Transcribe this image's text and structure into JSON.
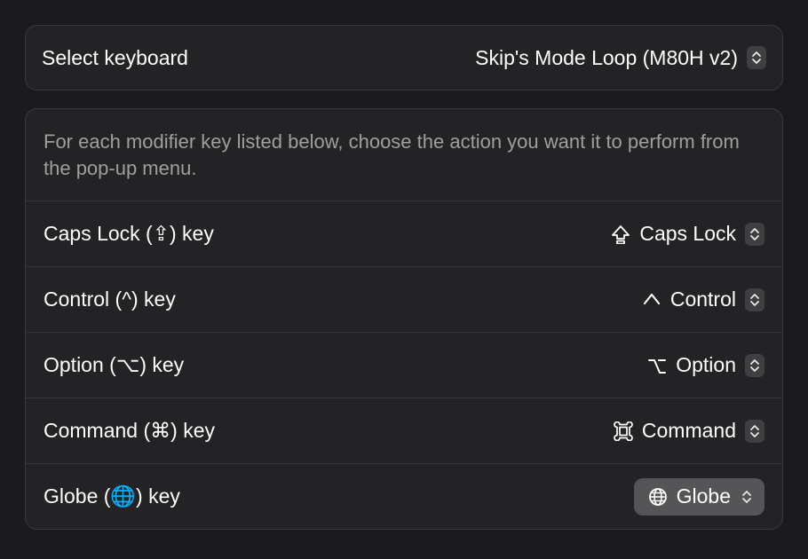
{
  "keyboard_selector": {
    "label": "Select keyboard",
    "value": "Skip's Mode Loop (M80H v2)"
  },
  "description": "For each modifier key listed below, choose the action you want it to perform from the pop-up menu.",
  "rows": [
    {
      "label": "Caps Lock (⇪) key",
      "icon": "capslock",
      "value": "Caps Lock",
      "selected": false
    },
    {
      "label": "Control (^) key",
      "icon": "control",
      "value": "Control",
      "selected": false
    },
    {
      "label": "Option (⌥) key",
      "icon": "option",
      "value": "Option",
      "selected": false
    },
    {
      "label": "Command (⌘) key",
      "icon": "command",
      "value": "Command",
      "selected": false
    },
    {
      "label": "Globe (🌐) key",
      "icon": "globe",
      "value": "Globe",
      "selected": true
    }
  ]
}
